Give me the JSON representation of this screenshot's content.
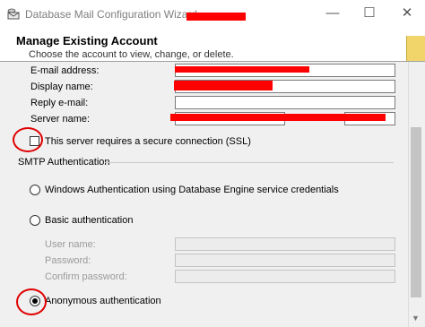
{
  "window": {
    "title": "Database Mail Configuration Wizard -",
    "minimize_glyph": "—",
    "maximize_glyph": "☐",
    "close_glyph": "✕"
  },
  "header": {
    "title": "Manage Existing Account",
    "subtitle": "Choose the account to view, change, or delete."
  },
  "account_fields": {
    "email_label": "E-mail address:",
    "display_name_label": "Display name:",
    "reply_email_label": "Reply e-mail:",
    "server_name_label": "Server name:"
  },
  "ssl": {
    "label": "This server requires a secure connection (SSL)",
    "checked": false
  },
  "smtp": {
    "group_label": "SMTP Authentication",
    "windows_auth_label": "Windows Authentication using Database Engine service credentials",
    "basic_auth_label": "Basic authentication",
    "user_name_label": "User name:",
    "password_label": "Password:",
    "confirm_password_label": "Confirm password:",
    "anonymous_auth_label": "Anonymous authentication",
    "selected": "anonymous"
  },
  "colors": {
    "annotation": "#e00000",
    "redaction": "#ff0000"
  }
}
